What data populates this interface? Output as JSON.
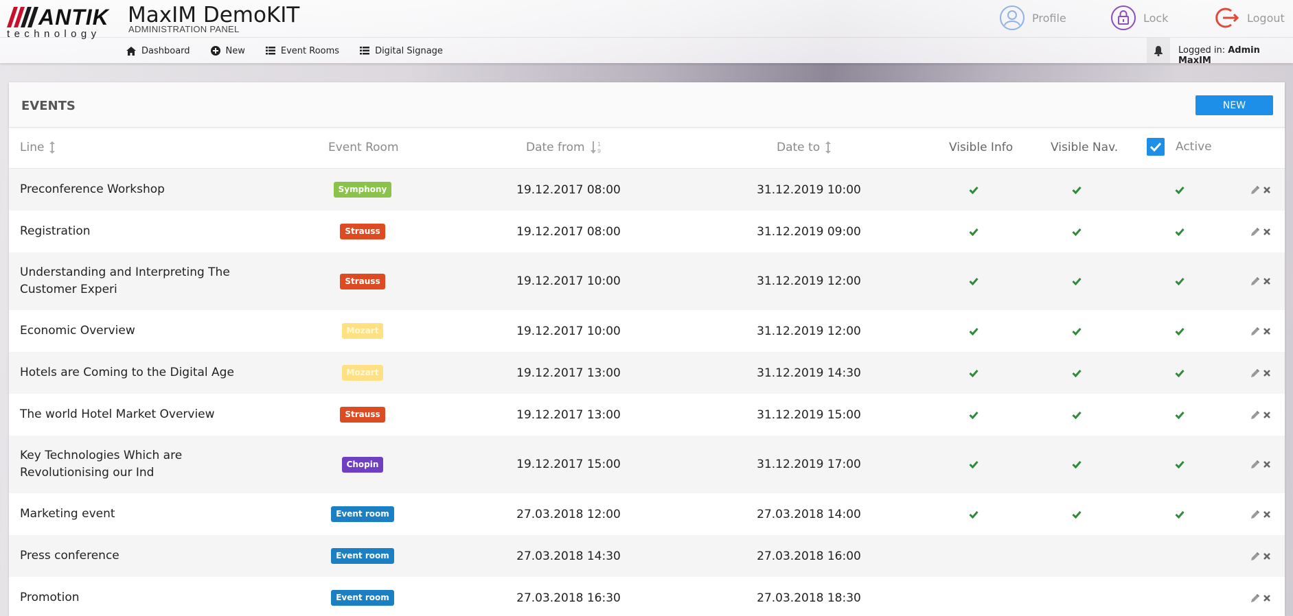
{
  "brand": {
    "logo_word": "ANTIK",
    "logo_sub": "technology",
    "app_title": "MaxIM DemoKIT",
    "app_subtitle": "ADMINISTRATION PANEL"
  },
  "top_actions": {
    "profile": "Profile",
    "lock": "Lock",
    "logout": "Logout"
  },
  "nav": {
    "dashboard": "Dashboard",
    "new": "New",
    "event_rooms": "Event Rooms",
    "digital_signage": "Digital Signage"
  },
  "session": {
    "logged_label": "Logged in:",
    "user": "Admin MaxIM"
  },
  "panel": {
    "title": "EVENTS",
    "new_button": "NEW"
  },
  "columns": {
    "line": "Line",
    "event_room": "Event Room",
    "date_from": "Date from",
    "date_to": "Date to",
    "visible_info": "Visible Info",
    "visible_nav": "Visible Nav.",
    "active": "Active"
  },
  "room_colors": {
    "Symphony": "#8bc34a",
    "Strauss": "#dd4b22",
    "Mozart": "#ffe083",
    "Chopin": "#6f3fc1",
    "Event room": "#1b7fc4"
  },
  "events": [
    {
      "line": "Preconference Workshop",
      "room": "Symphony",
      "from": "19.12.2017 08:00",
      "to": "31.12.2019 10:00",
      "visible_info": true,
      "visible_nav": true,
      "active": true
    },
    {
      "line": "Registration",
      "room": "Strauss",
      "from": "19.12.2017 08:00",
      "to": "31.12.2019 09:00",
      "visible_info": true,
      "visible_nav": true,
      "active": true
    },
    {
      "line": "Understanding and Interpreting The Customer Experi",
      "room": "Strauss",
      "from": "19.12.2017 10:00",
      "to": "31.12.2019 12:00",
      "visible_info": true,
      "visible_nav": true,
      "active": true
    },
    {
      "line": "Economic Overview",
      "room": "Mozart",
      "from": "19.12.2017 10:00",
      "to": "31.12.2019 12:00",
      "visible_info": true,
      "visible_nav": true,
      "active": true
    },
    {
      "line": "Hotels are Coming to the Digital Age",
      "room": "Mozart",
      "from": "19.12.2017 13:00",
      "to": "31.12.2019 14:30",
      "visible_info": true,
      "visible_nav": true,
      "active": true
    },
    {
      "line": "The world Hotel Market Overview",
      "room": "Strauss",
      "from": "19.12.2017 13:00",
      "to": "31.12.2019 15:00",
      "visible_info": true,
      "visible_nav": true,
      "active": true
    },
    {
      "line": "Key Technologies Which are Revolutionising our Ind",
      "room": "Chopin",
      "from": "19.12.2017 15:00",
      "to": "31.12.2019 17:00",
      "visible_info": true,
      "visible_nav": true,
      "active": true
    },
    {
      "line": "Marketing event",
      "room": "Event room",
      "from": "27.03.2018 12:00",
      "to": "27.03.2018 14:00",
      "visible_info": true,
      "visible_nav": true,
      "active": true
    },
    {
      "line": "Press conference",
      "room": "Event room",
      "from": "27.03.2018 14:30",
      "to": "27.03.2018 16:00",
      "visible_info": false,
      "visible_nav": false,
      "active": false
    },
    {
      "line": "Promotion",
      "room": "Event room",
      "from": "27.03.2018 16:30",
      "to": "27.03.2018 18:30",
      "visible_info": false,
      "visible_nav": false,
      "active": false
    }
  ]
}
